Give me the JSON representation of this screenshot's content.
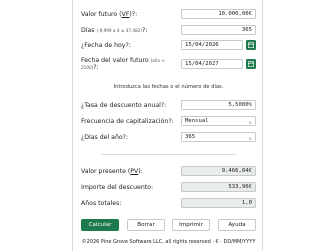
{
  "fields": {
    "future_value": {
      "label_prefix": "Valor futuro (",
      "label_abbr": "VF",
      "label_suffix": ")?:",
      "value": "10.000,00€"
    },
    "days": {
      "label": "Días ",
      "label_hint": "(-9,999 a 4 ≤ 47,482)",
      "label_suffix": "?:",
      "value": "365"
    },
    "today_date": {
      "label": "¿Fecha de hoy?:",
      "value": "15/04/2026"
    },
    "future_date": {
      "label": "Fecha del valor futuro ",
      "label_hint": "(año < 2100)",
      "label_suffix": "?:",
      "value": "15/04/2027"
    },
    "discount_rate": {
      "label": "¿Tasa de descuento anual?:",
      "value": "5,5000%"
    },
    "frequency": {
      "label": "Frecuencia de capitalización?:",
      "selected": "Mensual"
    },
    "days_per_year": {
      "label": "¿Días del año?:",
      "selected": "365"
    },
    "present_value": {
      "label_prefix": "Valor presente (",
      "label_abbr": "PV",
      "label_suffix": "):",
      "value": "9.466,04€"
    },
    "discount_amount": {
      "label": "Importe del descuento:",
      "value": "533,96€"
    },
    "total_years": {
      "label": "Años totales:",
      "value": "1,0"
    }
  },
  "hint_text": "Introduzca las fechas o el número de días.",
  "buttons": {
    "calculate": "Calcular",
    "clear": "Borrar",
    "print": "Imprimir",
    "help": "Ayuda"
  },
  "footer": "©2026 Pine Grove Software LLC, all rights reserved · € · DD/MM/YYYY",
  "icons": {
    "calendar": "calendar-icon",
    "chevron": "chevron-down-icon"
  },
  "colors": {
    "accent": "#1d7a4c",
    "readonly_bg": "#e9ecea",
    "border": "#c5cbc8"
  }
}
